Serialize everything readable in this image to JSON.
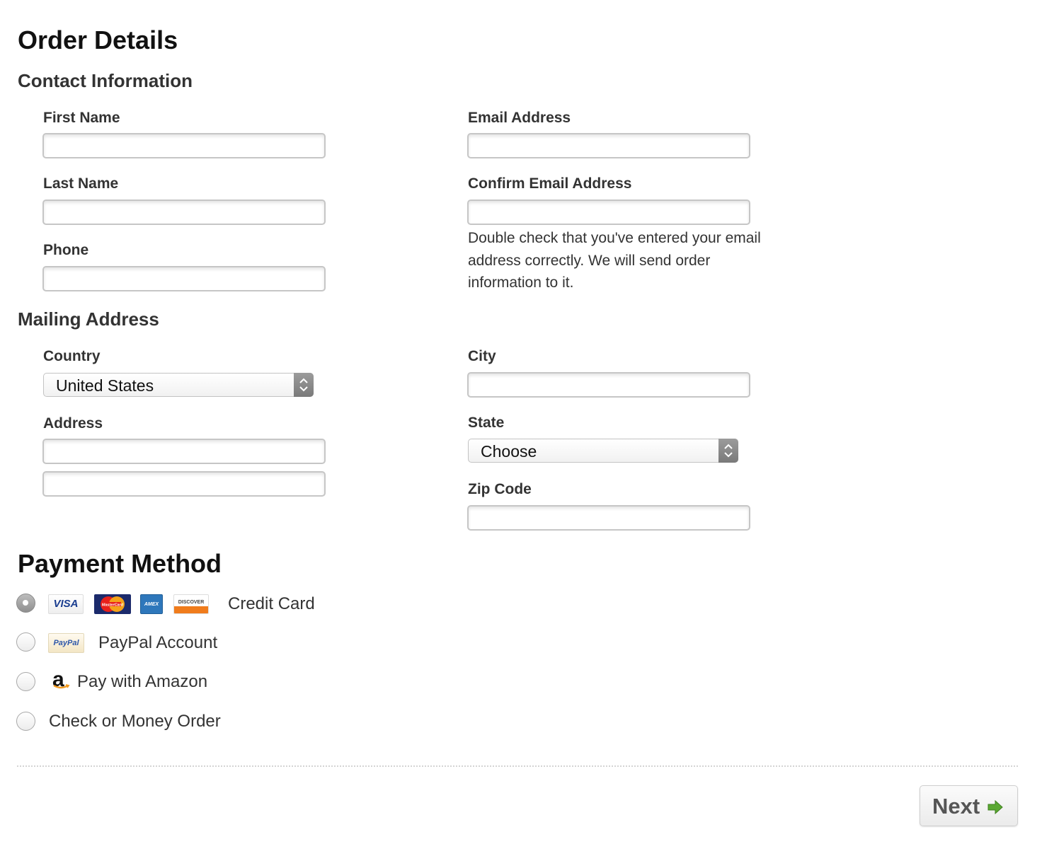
{
  "page": {
    "title": "Order Details"
  },
  "contact": {
    "heading": "Contact Information",
    "first_name_label": "First Name",
    "last_name_label": "Last Name",
    "phone_label": "Phone",
    "email_label": "Email Address",
    "confirm_email_label": "Confirm Email Address",
    "confirm_email_help": "Double check that you've entered your email address correctly. We will send order information to it.",
    "first_name_value": "",
    "last_name_value": "",
    "phone_value": "",
    "email_value": "",
    "confirm_email_value": ""
  },
  "mailing": {
    "heading": "Mailing Address",
    "country_label": "Country",
    "country_selected": "United States",
    "address_label": "Address",
    "city_label": "City",
    "state_label": "State",
    "state_selected": "Choose",
    "zip_label": "Zip Code"
  },
  "payment": {
    "heading": "Payment Method",
    "options": [
      {
        "label": "Credit Card",
        "selected": true
      },
      {
        "label": "PayPal Account",
        "selected": false
      },
      {
        "label": "Pay with Amazon",
        "selected": false
      },
      {
        "label": "Check or Money Order",
        "selected": false
      }
    ],
    "card_logos": {
      "visa": "VISA",
      "mastercard": "MasterCard",
      "amex": "AMEX",
      "discover": "DISCOVER",
      "paypal": "PayPal",
      "amazon": "a"
    }
  },
  "footer": {
    "next_label": "Next"
  },
  "colors": {
    "next_arrow": "#5aa832",
    "visa_blue": "#1a3d8f",
    "mastercard_bg": "#1b2a6b",
    "amex_blue": "#2e77bb",
    "discover_orange": "#f07c1c",
    "amazon_orange": "#f29a1f"
  }
}
